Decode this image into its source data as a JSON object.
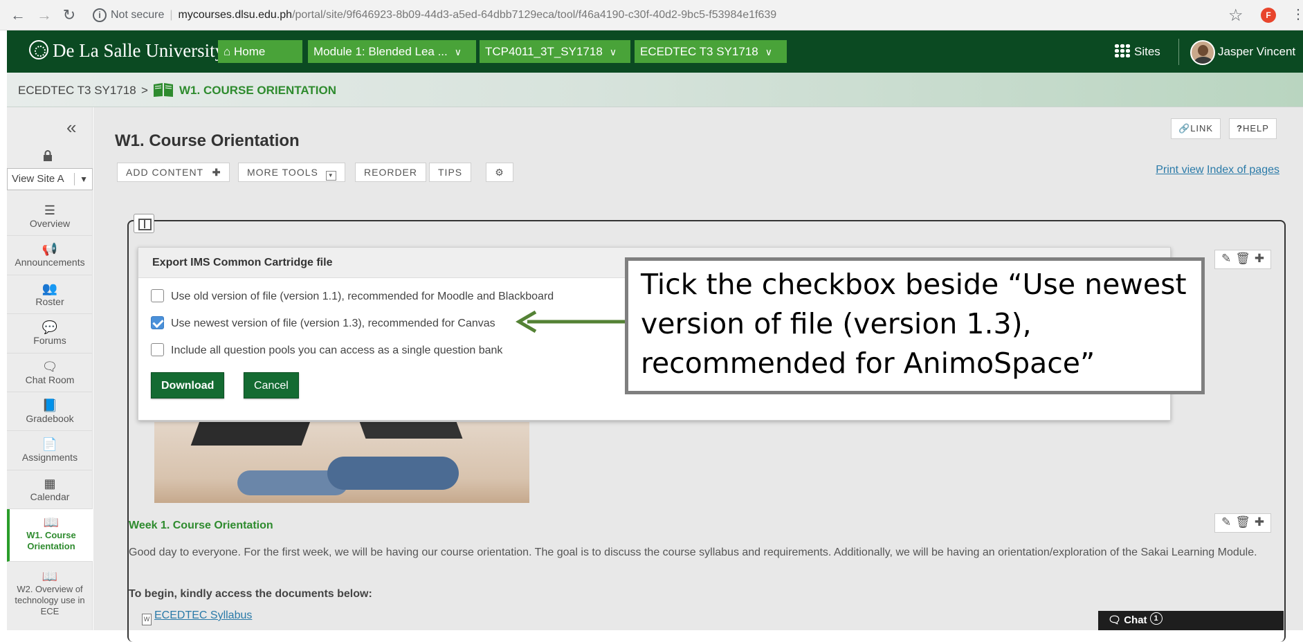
{
  "browser": {
    "not_secure": "Not secure",
    "host": "mycourses.dlsu.edu.ph",
    "path": "/portal/site/9f646923-8b09-44d3-a5ed-64dbb7129eca/tool/f46a4190-c30f-40d2-9bc5-f53984e1f639",
    "profile_initial": "F"
  },
  "header": {
    "logo": "De La Salle University",
    "tabs": [
      "Home",
      "Module 1: Blended Lea ...",
      "TCP4011_3T_SY1718",
      "ECEDTEC T3 SY1718"
    ],
    "sites_label": "Sites",
    "user_name": "Jasper Vincent"
  },
  "breadcrumb": {
    "site": "ECEDTEC T3 SY1718",
    "separator": ">",
    "current": "W1. COURSE ORIENTATION"
  },
  "sidebar": {
    "view_site": "View Site A",
    "items": [
      {
        "label": "Overview",
        "icon": "list-icon"
      },
      {
        "label": "Announcements",
        "icon": "megaphone-icon"
      },
      {
        "label": "Roster",
        "icon": "users-icon"
      },
      {
        "label": "Forums",
        "icon": "comments-icon"
      },
      {
        "label": "Chat Room",
        "icon": "chat-icon"
      },
      {
        "label": "Gradebook",
        "icon": "book-icon"
      },
      {
        "label": "Assignments",
        "icon": "file-icon"
      },
      {
        "label": "Calendar",
        "icon": "calendar-icon"
      },
      {
        "label": "W1. Course Orientation",
        "icon": "open-book-icon"
      },
      {
        "label": "W2. Overview of technology use in ECE",
        "icon": "open-book-icon"
      }
    ]
  },
  "page": {
    "title": "W1. Course Orientation",
    "toolbar": {
      "add_content": "ADD CONTENT",
      "more_tools": "MORE TOOLS",
      "reorder": "REORDER",
      "tips": "TIPS"
    },
    "link_btn": "LINK",
    "help_btn": "HELP",
    "print_view": "Print view",
    "index_of_pages": "Index of pages"
  },
  "dialog": {
    "title": "Export IMS Common Cartridge file",
    "options": [
      {
        "label": "Use old version of file (version 1.1), recommended for Moodle and Blackboard",
        "checked": false
      },
      {
        "label": "Use newest version of file (version 1.3), recommended for Canvas",
        "checked": true
      },
      {
        "label": "Include all question pools you can access as a single question bank",
        "checked": false
      }
    ],
    "download": "Download",
    "cancel": "Cancel"
  },
  "annotation": {
    "text": "Tick the checkbox beside “Use newest version of file (version 1.3), recommended for AnimoSpace”",
    "arrow_color": "#548235"
  },
  "content": {
    "week_title": "Week 1. Course Orientation",
    "week_body": "Good day to everyone. For the first week, we will be having our course orientation. The goal is to discuss the course syllabus and requirements. Additionally, we will be having an orientation/exploration of the Sakai Learning Module.",
    "begin_text": "To begin, kindly access the documents below:",
    "doc_link": "ECEDTEC Syllabus"
  },
  "chat": {
    "label": "Chat",
    "count": "1"
  },
  "colors": {
    "header_green": "#0b4a22",
    "tab_green": "#49a339",
    "accent_green": "#2e8b2e",
    "button_green": "#146b32"
  }
}
